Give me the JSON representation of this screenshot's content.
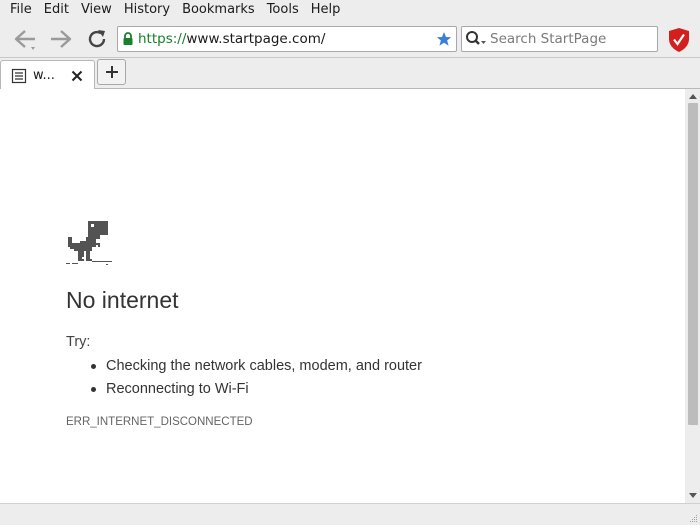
{
  "menubar": {
    "items": [
      "File",
      "Edit",
      "View",
      "History",
      "Bookmarks",
      "Tools",
      "Help"
    ]
  },
  "toolbar": {
    "back_icon": "back-arrow-icon",
    "forward_icon": "forward-arrow-icon",
    "reload_icon": "reload-icon",
    "url_scheme": "https://",
    "url_rest": "www.startpage.com/",
    "search_placeholder": "Search StartPage"
  },
  "tabs": [
    {
      "label": "w...",
      "icon": "page-icon"
    }
  ],
  "page": {
    "heading": "No internet",
    "try_label": "Try:",
    "suggestions": [
      "Checking the network cables, modem, and router",
      "Reconnecting to Wi-Fi"
    ],
    "error_code": "ERR_INTERNET_DISCONNECTED"
  },
  "colors": {
    "chrome_bg": "#ededed",
    "secure_green": "#17802a",
    "star_blue": "#3b7fd9",
    "shield_red": "#d41f1f"
  }
}
